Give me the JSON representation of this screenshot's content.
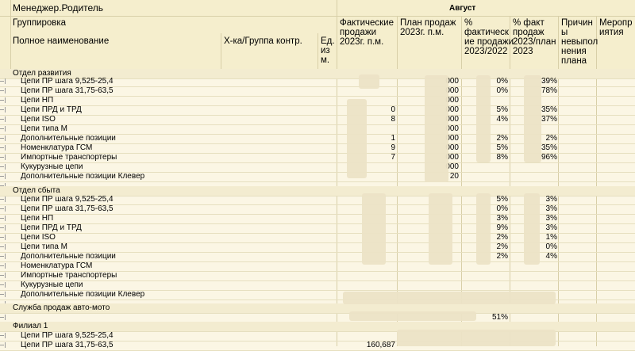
{
  "header": {
    "manager_label": "Менеджер.Родитель",
    "grouping_label": "Группировка",
    "full_name_label": "Полное наименование",
    "kontr_label": "Х-ка/Группа контр.",
    "unit_label_1": "Ед.",
    "unit_label_2": "из",
    "unit_label_3": "м.",
    "month": "Август",
    "fact_1": "Фактические",
    "fact_2": "продажи",
    "fact_3": "2023г. п.м.",
    "plan_1": "План продаж",
    "plan_2": "2023г. п.м.",
    "pct_1": "%",
    "pct_2": "фактическ",
    "pct_3": "ие продажи",
    "pct_4": "2023/2022",
    "pctplan_1": "% факт",
    "pctplan_2": "продаж",
    "pctplan_3": "2023/план",
    "pctplan_4": "2023",
    "reason_1": "Причин",
    "reason_2": "ы",
    "reason_3": "невыпол",
    "reason_4": "нения",
    "reason_5": "плана",
    "measures_1": "Меропр",
    "measures_2": "иятия"
  },
  "groups": {
    "g1": "Отдел развития",
    "g2": "Отдел сбыта",
    "g3": "Служба продаж авто-мото",
    "g4": "Филиал 1"
  },
  "rows1": [
    "Цепи ПР шага 9,525-25,4",
    "Цепи ПР шага 31,75-63,5",
    "Цепи НП",
    "Цепи ПРД и ТРД",
    "Цепи ISO",
    "Цепи типа М",
    "Дополнительные позиции",
    "Номенклатура ГСМ",
    "Импортные транспортеры",
    "Кукурузные цепи",
    "Дополнительные позиции Клевер"
  ],
  "rows2": [
    "Цепи ПР шага 9,525-25,4",
    "Цепи ПР шага 31,75-63,5",
    "Цепи НП",
    "Цепи ПРД и ТРД",
    "Цепи ISO",
    "Цепи типа М",
    "Дополнительные позиции",
    "Номенклатура ГСМ",
    "Импортные транспортеры",
    "Кукурузные цепи",
    "Дополнительные позиции Клевер"
  ],
  "rows4": [
    "Цепи ПР шага 9,525-25,4",
    "Цепи ПР шага 31,75-63,5"
  ],
  "values": {
    "r1_plan": "000",
    "r1_pct": "0%",
    "r1_pp": "39%",
    "r2_plan": "000",
    "r2_pct": "0%",
    "r2_pp": "78%",
    "r3_plan": "000",
    "r4_fact": "0",
    "r4_plan": "000",
    "r4_pct": "5%",
    "r4_pp": "35%",
    "r5_fact": "8",
    "r5_plan": "000",
    "r5_pct": "4%",
    "r5_pp": "37%",
    "r6_plan": "000",
    "r7_fact": "1",
    "r7_plan": "000",
    "r7_pct": "2%",
    "r7_pp": "2%",
    "r8_fact": "9",
    "r8_plan": "000",
    "r8_pct": "5%",
    "r8_pp": "35%",
    "r9_fact": "7",
    "r9_plan": "000",
    "r9_pct": "8%",
    "r9_pp": "96%",
    "r10_plan": "000",
    "r11_plan": "20",
    "s1_pct": "5%",
    "s1_pp": "3%",
    "s2_pct": "0%",
    "s2_pp": "3%",
    "s3_pct": "3%",
    "s3_pp": "3%",
    "s4_pct": "9%",
    "s4_pp": "3%",
    "s5_pct": "2%",
    "s5_pp": "1%",
    "s6_pct": "2%",
    "s6_pp": "0%",
    "s7_pct": "2%",
    "s7_pp": "4%",
    "auto_pct": "51%",
    "f2_fact": "160,687"
  }
}
